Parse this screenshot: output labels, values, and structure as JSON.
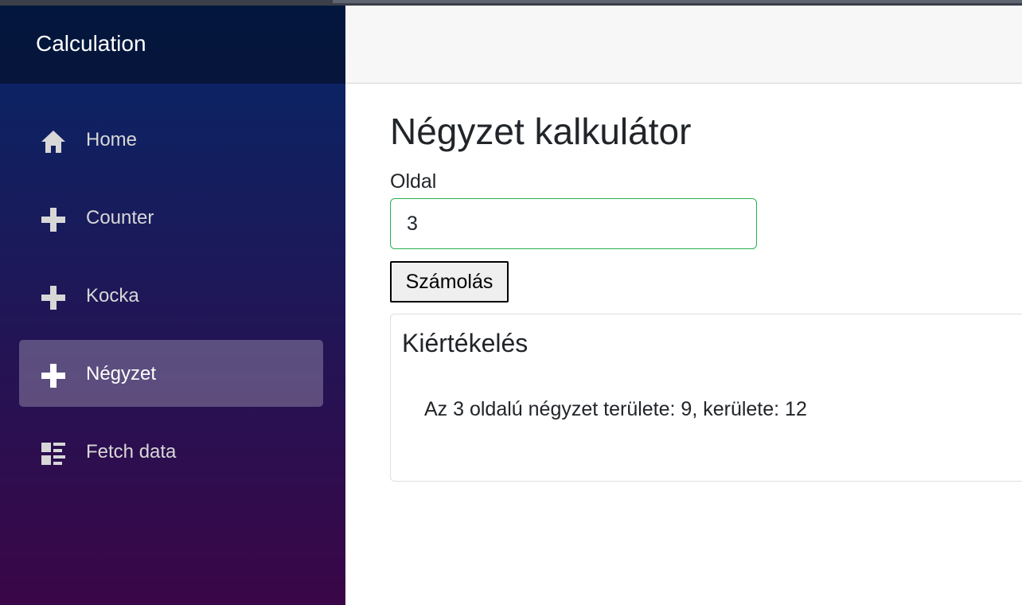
{
  "app": {
    "brand": "Calculation"
  },
  "sidebar": {
    "items": [
      {
        "label": "Home",
        "icon": "home-icon",
        "active": false
      },
      {
        "label": "Counter",
        "icon": "plus-icon",
        "active": false
      },
      {
        "label": "Kocka",
        "icon": "plus-icon",
        "active": false
      },
      {
        "label": "Négyzet",
        "icon": "plus-icon",
        "active": true
      },
      {
        "label": "Fetch data",
        "icon": "list-rich-icon",
        "active": false
      }
    ]
  },
  "main": {
    "title": "Négyzet kalkulátor",
    "side_label": "Oldal",
    "side_value": "3",
    "button_label": "Számolás",
    "result": {
      "title": "Kiértékelés",
      "text": "Az 3 oldalú négyzet területe: 9, kerülete: 12"
    }
  },
  "colors": {
    "sidebar_top": "#052767",
    "sidebar_bottom": "#3a0647",
    "input_border": "#26b050",
    "topbar": "#f7f7f7"
  }
}
